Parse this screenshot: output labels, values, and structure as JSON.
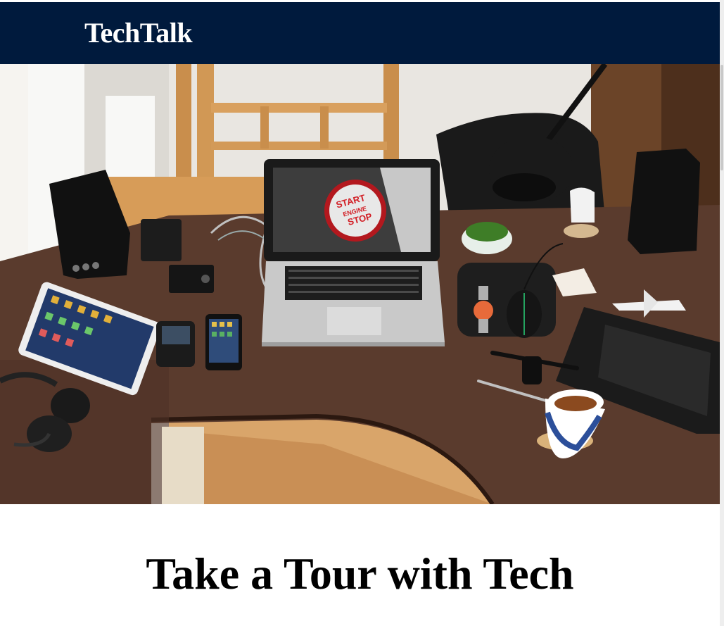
{
  "navbar": {
    "brand": "TechTalk"
  },
  "hero": {
    "image_name": "tech-desk-photo",
    "laptop_screen_text": [
      "START",
      "ENGINE",
      "STOP"
    ]
  },
  "main": {
    "heading": "Take a Tour with Tech"
  },
  "colors": {
    "navbar_bg": "#001a3d",
    "brand_text": "#ffffff",
    "heading_text": "#000000"
  }
}
